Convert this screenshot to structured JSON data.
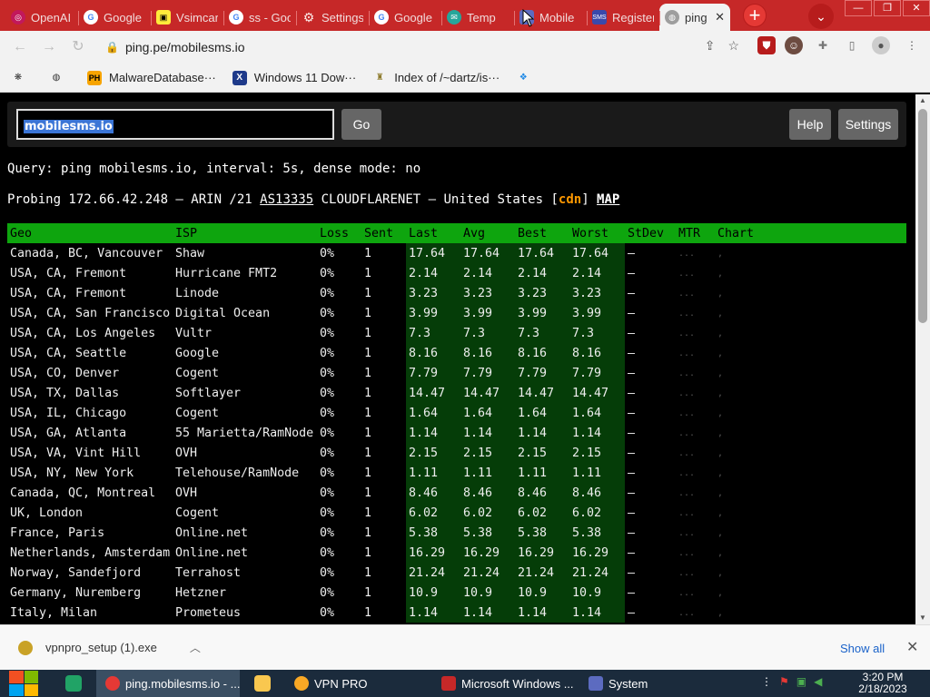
{
  "browser": {
    "tabs": [
      {
        "title": "OpenAI",
        "icon": "openai-icon"
      },
      {
        "title": "Google",
        "icon": "google-icon"
      },
      {
        "title": "Vsimcard",
        "icon": "vsim-icon"
      },
      {
        "title": "ss - Google",
        "icon": "google-icon"
      },
      {
        "title": "Settings",
        "icon": "gear-icon"
      },
      {
        "title": "Google",
        "icon": "google-icon"
      },
      {
        "title": "Temp",
        "icon": "temp-mail-icon"
      },
      {
        "title": "Mobile",
        "icon": "mobile-icon"
      },
      {
        "title": "Register",
        "icon": "sms-icon"
      },
      {
        "title": "ping",
        "icon": "globe-icon",
        "active": true
      }
    ],
    "new_tab_symbol": "+",
    "tab_search_symbol": "⌄",
    "url": "ping.pe/mobilesms.io",
    "bookmarks": [
      {
        "label": "",
        "icon": "paw-icon"
      },
      {
        "label": "",
        "icon": "globe-icon"
      },
      {
        "label": "MalwareDatabase···",
        "icon": "ph-icon"
      },
      {
        "label": "Windows 11 Dow···",
        "icon": "x-icon"
      },
      {
        "label": "Index of /~dartz/is···",
        "icon": "folder-icon"
      },
      {
        "label": "",
        "icon": "doc-icon"
      }
    ]
  },
  "page": {
    "host_value": "mobilesms.io",
    "go_label": "Go",
    "help_label": "Help",
    "settings_label": "Settings",
    "query_line": "Query: ping mobilesms.io, interval: 5s, dense mode: no",
    "probe": {
      "prefix": "Probing 172.66.42.248 — ARIN /21 ",
      "asn": "AS13335",
      "middle": " CLOUDFLARENET — United States [",
      "cdn": "cdn",
      "close": "] ",
      "map": "MAP"
    },
    "table": {
      "headers": [
        "Geo",
        "ISP",
        "Loss",
        "Sent",
        "Last",
        "Avg",
        "Best",
        "Worst",
        "StDev",
        "MTR",
        "Chart"
      ],
      "rows": [
        [
          "Canada, BC, Vancouver",
          "Shaw",
          "0%",
          "1",
          "17.64",
          "17.64",
          "17.64",
          "17.64",
          "–",
          "...",
          ","
        ],
        [
          "USA, CA, Fremont",
          "Hurricane FMT2",
          "0%",
          "1",
          "2.14",
          "2.14",
          "2.14",
          "2.14",
          "–",
          "...",
          ","
        ],
        [
          "USA, CA, Fremont",
          "Linode",
          "0%",
          "1",
          "3.23",
          "3.23",
          "3.23",
          "3.23",
          "–",
          "...",
          ","
        ],
        [
          "USA, CA, San Francisco",
          "Digital Ocean",
          "0%",
          "1",
          "3.99",
          "3.99",
          "3.99",
          "3.99",
          "–",
          "...",
          ","
        ],
        [
          "USA, CA, Los Angeles",
          "Vultr",
          "0%",
          "1",
          "7.3",
          "7.3",
          "7.3",
          "7.3",
          "–",
          "...",
          ","
        ],
        [
          "USA, CA, Seattle",
          "Google",
          "0%",
          "1",
          "8.16",
          "8.16",
          "8.16",
          "8.16",
          "–",
          "...",
          ","
        ],
        [
          "USA, CO, Denver",
          "Cogent",
          "0%",
          "1",
          "7.79",
          "7.79",
          "7.79",
          "7.79",
          "–",
          "...",
          ","
        ],
        [
          "USA, TX, Dallas",
          "Softlayer",
          "0%",
          "1",
          "14.47",
          "14.47",
          "14.47",
          "14.47",
          "–",
          "...",
          ","
        ],
        [
          "USA, IL, Chicago",
          "Cogent",
          "0%",
          "1",
          "1.64",
          "1.64",
          "1.64",
          "1.64",
          "–",
          "...",
          ","
        ],
        [
          "USA, GA, Atlanta",
          "55 Marietta/RamNode",
          "0%",
          "1",
          "1.14",
          "1.14",
          "1.14",
          "1.14",
          "–",
          "...",
          ","
        ],
        [
          "USA, VA, Vint Hill",
          "OVH",
          "0%",
          "1",
          "2.15",
          "2.15",
          "2.15",
          "2.15",
          "–",
          "...",
          ","
        ],
        [
          "USA, NY, New York",
          "Telehouse/RamNode",
          "0%",
          "1",
          "1.11",
          "1.11",
          "1.11",
          "1.11",
          "–",
          "...",
          ","
        ],
        [
          "Canada, QC, Montreal",
          "OVH",
          "0%",
          "1",
          "8.46",
          "8.46",
          "8.46",
          "8.46",
          "–",
          "...",
          ","
        ],
        [
          "UK, London",
          "Cogent",
          "0%",
          "1",
          "6.02",
          "6.02",
          "6.02",
          "6.02",
          "–",
          "...",
          ","
        ],
        [
          "France, Paris",
          "Online.net",
          "0%",
          "1",
          "5.38",
          "5.38",
          "5.38",
          "5.38",
          "–",
          "...",
          ","
        ],
        [
          "Netherlands, Amsterdam",
          "Online.net",
          "0%",
          "1",
          "16.29",
          "16.29",
          "16.29",
          "16.29",
          "–",
          "...",
          ","
        ],
        [
          "Norway, Sandefjord",
          "Terrahost",
          "0%",
          "1",
          "21.24",
          "21.24",
          "21.24",
          "21.24",
          "–",
          "...",
          ","
        ],
        [
          "Germany, Nuremberg",
          "Hetzner",
          "0%",
          "1",
          "10.9",
          "10.9",
          "10.9",
          "10.9",
          "–",
          "...",
          ","
        ],
        [
          "Italy, Milan",
          "Prometeus",
          "0%",
          "1",
          "1.14",
          "1.14",
          "1.14",
          "1.14",
          "–",
          "...",
          ","
        ]
      ]
    }
  },
  "downloads": {
    "filename": "vpnpro_setup (1).exe",
    "show_all": "Show all"
  },
  "taskbar": {
    "apps": [
      {
        "label": "ping.mobilesms.io - ..."
      },
      {
        "label": "VPN PRO"
      },
      {
        "label": "Microsoft Windows ..."
      },
      {
        "label": "System"
      }
    ],
    "time": "3:20 PM",
    "date": "2/18/2023"
  },
  "colors": {
    "tab_strip": "#c62828",
    "header_green": "#0ea50e",
    "latency_bg": "#053d08",
    "cdn_orange": "#ff9800",
    "selection_blue": "#3b75d6"
  }
}
